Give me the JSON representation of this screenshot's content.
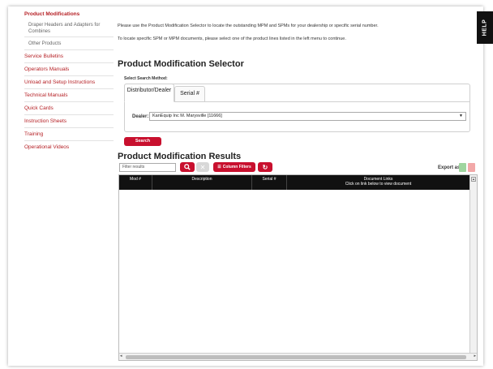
{
  "help": {
    "label": "HELP"
  },
  "sidebar": {
    "title": "Product Modifications",
    "sub_items": [
      "Draper Headers and Adapters for Combines",
      "Other Products"
    ],
    "items": [
      "Service Bulletins",
      "Operators Manuals",
      "Unload and Setup Instructions",
      "Technical Manuals",
      "Quick Cards",
      "Instruction Sheets",
      "Training",
      "Operational Videos"
    ]
  },
  "intro": {
    "line1": "Please use the Product Modification Selector to locate the outstanding MPM and SPMs for your dealership or specific serial number.",
    "line2": "To locate specific SPM or MPM documents, please select one of the product lines listed in the left menu to continue."
  },
  "selector": {
    "title": "Product Modification Selector",
    "method_label": "Select Search Method:",
    "tabs": [
      "Distributor/Dealer",
      "Serial #"
    ],
    "dealer_label": "Dealer:",
    "dealer_value": "KanEquip Inc M. Marysville [11666]",
    "search_button": "Search"
  },
  "results": {
    "title": "Product Modification Results",
    "filter_placeholder": "Filter results",
    "column_filters_label": "Column Filters",
    "export_label": "Export as:",
    "columns": [
      {
        "label": "Mod #",
        "sub": ""
      },
      {
        "label": "Description",
        "sub": ""
      },
      {
        "label": "Serial #",
        "sub": ""
      },
      {
        "label": "Document Links",
        "sub": "Click on link below to view document"
      }
    ]
  },
  "colors": {
    "accent": "#c8102e",
    "header_bg": "#111111",
    "link": "#b51f24"
  }
}
